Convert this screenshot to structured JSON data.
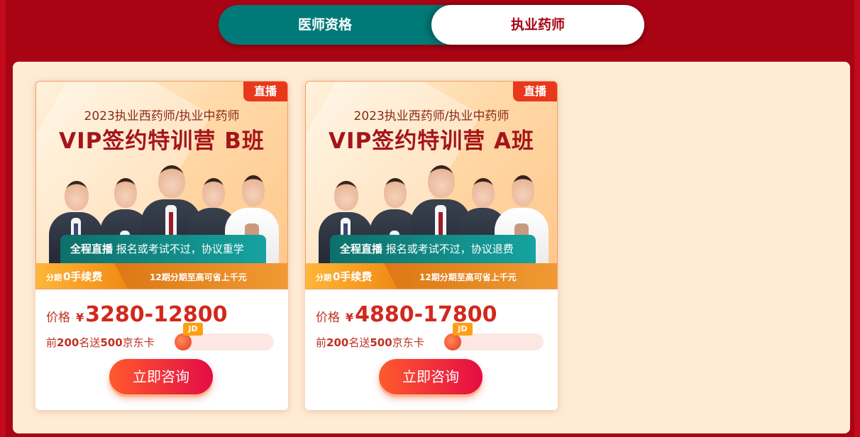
{
  "tabs": [
    {
      "label": "医师资格",
      "active": false
    },
    {
      "label": "执业药师",
      "active": true
    }
  ],
  "colors": {
    "page_bg": "#a80414",
    "panel_bg": "#ffecd6",
    "tab_inactive": "#007a78",
    "tab_active_text": "#a80414",
    "price_red": "#d2281c",
    "cta_gradient": [
      "#ff5a2e",
      "#e40c44"
    ]
  },
  "cards": [
    {
      "live_tag": "直播",
      "subject": "2023执业西药师/执业中药师",
      "title": "VIP签约特训营 B班",
      "slogan_bold": "全程直播",
      "slogan_rest": " 报名或考试不过，协议重学",
      "installment_small": "分期",
      "installment_big": "0手续费",
      "installment_note": "12期分期至高可省上千元",
      "price_label": "价格",
      "currency": "¥",
      "price": "3280-12800",
      "promo_prefix": "前",
      "promo_count": "200",
      "promo_mid": "名送",
      "promo_amount": "500",
      "promo_suffix": "京东卡",
      "promo_progress": 0.0,
      "jd_icon_text": "JD",
      "cta": "立即咨询"
    },
    {
      "live_tag": "直播",
      "subject": "2023执业西药师/执业中药师",
      "title": "VIP签约特训营 A班",
      "slogan_bold": "全程直播",
      "slogan_rest": " 报名或考试不过，协议退费",
      "installment_small": "分期",
      "installment_big": "0手续费",
      "installment_note": "12期分期至高可省上千元",
      "price_label": "价格",
      "currency": "¥",
      "price": "4880-17800",
      "promo_prefix": "前",
      "promo_count": "200",
      "promo_mid": "名送",
      "promo_amount": "500",
      "promo_suffix": "京东卡",
      "promo_progress": 0.0,
      "jd_icon_text": "JD",
      "cta": "立即咨询"
    }
  ]
}
